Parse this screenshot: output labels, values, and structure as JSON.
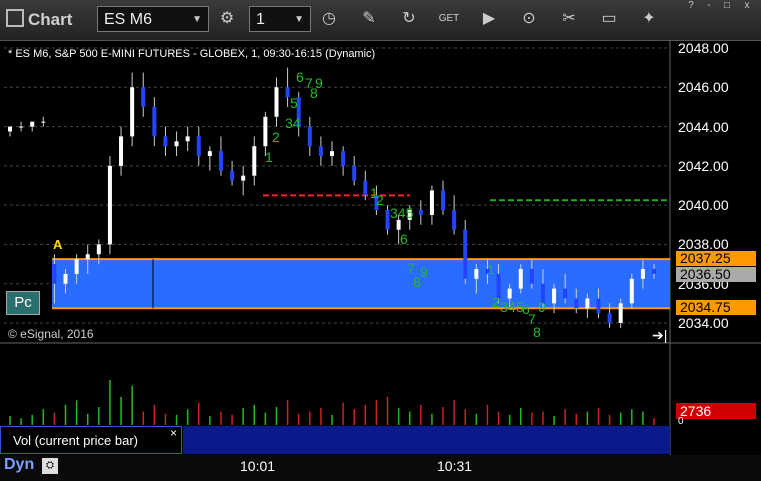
{
  "toolbar": {
    "app_title": "Chart",
    "symbol": "ES M6",
    "interval": "1",
    "icons": [
      "gear-icon",
      "clock-icon",
      "pencil-icon",
      "refresh-icon",
      "get-icon",
      "play-icon",
      "link-icon",
      "comment-icon",
      "twitter-icon"
    ]
  },
  "window": {
    "help": "?",
    "minimize": "-",
    "maximize": "□",
    "close": "x"
  },
  "chart": {
    "header": "* ES M6, S&P 500 E-MINI FUTURES - GLOBEX, 1, 09:30-16:15 (Dynamic)",
    "copyright": "© eSignal, 2016",
    "pc_label": "Pc",
    "a_label": "A",
    "price_labels": [
      "2048.00",
      "2046.00",
      "2044.00",
      "2042.00",
      "2040.00",
      "2038.00",
      "2036.00",
      "2034.00"
    ],
    "tags": {
      "high": "2037.25",
      "last": "2036.50",
      "low": "2034.75"
    },
    "time_labels": [
      "10:01",
      "10:31"
    ],
    "tpo_digits": [
      "6",
      "7",
      "9",
      "8",
      "5",
      "34",
      "2",
      "1",
      "1",
      "2",
      "345",
      "6",
      "7",
      "9",
      "8",
      "1",
      "2",
      "3",
      "4",
      "5",
      "6",
      "9",
      "7",
      "8"
    ],
    "colors": {
      "up": "#ffffff",
      "down": "#2244ff",
      "value_area": "#2a6cff",
      "orange": "#ff9900",
      "tpo": "#22bb22"
    }
  },
  "volume_panel": {
    "label": "Vol (current price bar)",
    "close": "×",
    "last_volume": "2736",
    "axis_zero": "0"
  },
  "footer": {
    "dyn_label": "Dyn",
    "dyn_icon": "lock-icon"
  },
  "chart_data": {
    "type": "candlestick",
    "title": "* ES M6, S&P 500 E-MINI FUTURES - GLOBEX, 1, 09:30-16:15 (Dynamic)",
    "ylim": [
      2033.5,
      2048.5
    ],
    "value_area_high": 2037.25,
    "value_area_low": 2034.75,
    "last": 2036.5,
    "red_line": 2040.5,
    "green_line": 2040.25,
    "candles": [
      {
        "o": 2043.75,
        "h": 2044.0,
        "l": 2043.5,
        "c": 2044.0
      },
      {
        "o": 2044.0,
        "h": 2044.25,
        "l": 2043.75,
        "c": 2044.0
      },
      {
        "o": 2044.0,
        "h": 2044.25,
        "l": 2043.75,
        "c": 2044.25
      },
      {
        "o": 2044.25,
        "h": 2044.5,
        "l": 2044.0,
        "c": 2044.25
      },
      {
        "o": 2037.0,
        "h": 2037.5,
        "l": 2035.0,
        "c": 2036.0
      },
      {
        "o": 2036.0,
        "h": 2036.75,
        "l": 2035.5,
        "c": 2036.5
      },
      {
        "o": 2036.5,
        "h": 2037.5,
        "l": 2036.0,
        "c": 2037.25
      },
      {
        "o": 2037.25,
        "h": 2038.0,
        "l": 2036.5,
        "c": 2037.5
      },
      {
        "o": 2037.5,
        "h": 2038.25,
        "l": 2037.0,
        "c": 2038.0
      },
      {
        "o": 2038.0,
        "h": 2042.5,
        "l": 2037.5,
        "c": 2042.0
      },
      {
        "o": 2042.0,
        "h": 2044.0,
        "l": 2041.5,
        "c": 2043.5
      },
      {
        "o": 2043.5,
        "h": 2046.75,
        "l": 2043.0,
        "c": 2046.0
      },
      {
        "o": 2046.0,
        "h": 2046.75,
        "l": 2044.5,
        "c": 2045.0
      },
      {
        "o": 2045.0,
        "h": 2045.5,
        "l": 2043.0,
        "c": 2043.5
      },
      {
        "o": 2043.5,
        "h": 2044.0,
        "l": 2042.5,
        "c": 2043.0
      },
      {
        "o": 2043.0,
        "h": 2043.75,
        "l": 2042.5,
        "c": 2043.25
      },
      {
        "o": 2043.25,
        "h": 2044.0,
        "l": 2042.75,
        "c": 2043.5
      },
      {
        "o": 2043.5,
        "h": 2044.0,
        "l": 2042.0,
        "c": 2042.5
      },
      {
        "o": 2042.5,
        "h": 2043.0,
        "l": 2041.75,
        "c": 2042.75
      },
      {
        "o": 2042.75,
        "h": 2043.5,
        "l": 2041.5,
        "c": 2041.75
      },
      {
        "o": 2041.75,
        "h": 2042.25,
        "l": 2041.0,
        "c": 2041.25
      },
      {
        "o": 2041.25,
        "h": 2042.0,
        "l": 2040.5,
        "c": 2041.5
      },
      {
        "o": 2041.5,
        "h": 2043.5,
        "l": 2041.0,
        "c": 2043.0
      },
      {
        "o": 2043.0,
        "h": 2044.75,
        "l": 2042.5,
        "c": 2044.5
      },
      {
        "o": 2044.5,
        "h": 2046.5,
        "l": 2044.0,
        "c": 2046.0
      },
      {
        "o": 2046.0,
        "h": 2047.0,
        "l": 2045.0,
        "c": 2045.5
      },
      {
        "o": 2045.5,
        "h": 2045.75,
        "l": 2043.5,
        "c": 2044.0
      },
      {
        "o": 2044.0,
        "h": 2044.5,
        "l": 2042.5,
        "c": 2043.0
      },
      {
        "o": 2043.0,
        "h": 2043.5,
        "l": 2042.0,
        "c": 2042.5
      },
      {
        "o": 2042.5,
        "h": 2043.25,
        "l": 2042.0,
        "c": 2042.75
      },
      {
        "o": 2042.75,
        "h": 2043.0,
        "l": 2041.5,
        "c": 2042.0
      },
      {
        "o": 2042.0,
        "h": 2042.5,
        "l": 2041.0,
        "c": 2041.25
      },
      {
        "o": 2041.25,
        "h": 2041.75,
        "l": 2040.25,
        "c": 2040.5
      },
      {
        "o": 2040.5,
        "h": 2041.0,
        "l": 2039.5,
        "c": 2039.75
      },
      {
        "o": 2039.75,
        "h": 2040.0,
        "l": 2038.5,
        "c": 2038.75
      },
      {
        "o": 2038.75,
        "h": 2039.5,
        "l": 2038.0,
        "c": 2039.25
      },
      {
        "o": 2039.25,
        "h": 2040.0,
        "l": 2038.75,
        "c": 2039.75
      },
      {
        "o": 2039.75,
        "h": 2040.25,
        "l": 2039.0,
        "c": 2039.5
      },
      {
        "o": 2039.5,
        "h": 2041.0,
        "l": 2039.0,
        "c": 2040.75
      },
      {
        "o": 2040.75,
        "h": 2041.25,
        "l": 2039.5,
        "c": 2039.75
      },
      {
        "o": 2039.75,
        "h": 2040.5,
        "l": 2038.5,
        "c": 2038.75
      },
      {
        "o": 2038.75,
        "h": 2039.25,
        "l": 2036.0,
        "c": 2036.25
      },
      {
        "o": 2036.25,
        "h": 2037.0,
        "l": 2035.5,
        "c": 2036.75
      },
      {
        "o": 2036.75,
        "h": 2037.25,
        "l": 2036.0,
        "c": 2036.5
      },
      {
        "o": 2036.5,
        "h": 2037.0,
        "l": 2035.0,
        "c": 2035.25
      },
      {
        "o": 2035.25,
        "h": 2036.0,
        "l": 2034.75,
        "c": 2035.75
      },
      {
        "o": 2035.75,
        "h": 2037.0,
        "l": 2035.5,
        "c": 2036.75
      },
      {
        "o": 2036.75,
        "h": 2037.25,
        "l": 2035.75,
        "c": 2036.0
      },
      {
        "o": 2036.0,
        "h": 2036.75,
        "l": 2034.75,
        "c": 2035.0
      },
      {
        "o": 2035.0,
        "h": 2036.0,
        "l": 2034.5,
        "c": 2035.75
      },
      {
        "o": 2035.75,
        "h": 2036.5,
        "l": 2035.0,
        "c": 2035.25
      },
      {
        "o": 2035.25,
        "h": 2035.75,
        "l": 2034.5,
        "c": 2034.75
      },
      {
        "o": 2034.75,
        "h": 2035.5,
        "l": 2034.25,
        "c": 2035.25
      },
      {
        "o": 2035.25,
        "h": 2035.75,
        "l": 2034.25,
        "c": 2034.5
      },
      {
        "o": 2034.5,
        "h": 2035.0,
        "l": 2033.75,
        "c": 2034.0
      },
      {
        "o": 2034.0,
        "h": 2035.25,
        "l": 2033.75,
        "c": 2035.0
      },
      {
        "o": 2035.0,
        "h": 2036.5,
        "l": 2034.75,
        "c": 2036.25
      },
      {
        "o": 2036.25,
        "h": 2037.25,
        "l": 2035.75,
        "c": 2036.75
      },
      {
        "o": 2036.75,
        "h": 2037.0,
        "l": 2036.25,
        "c": 2036.5
      }
    ],
    "volume": [
      8,
      6,
      9,
      14,
      11,
      18,
      22,
      10,
      16,
      40,
      25,
      35,
      12,
      18,
      10,
      9,
      14,
      20,
      8,
      12,
      9,
      15,
      18,
      11,
      16,
      22,
      10,
      12,
      15,
      9,
      20,
      14,
      18,
      22,
      25,
      15,
      12,
      18,
      10,
      16,
      22,
      14,
      10,
      18,
      12,
      9,
      15,
      11,
      12,
      8,
      14,
      10,
      12,
      15,
      9,
      11,
      14,
      12,
      6
    ]
  }
}
